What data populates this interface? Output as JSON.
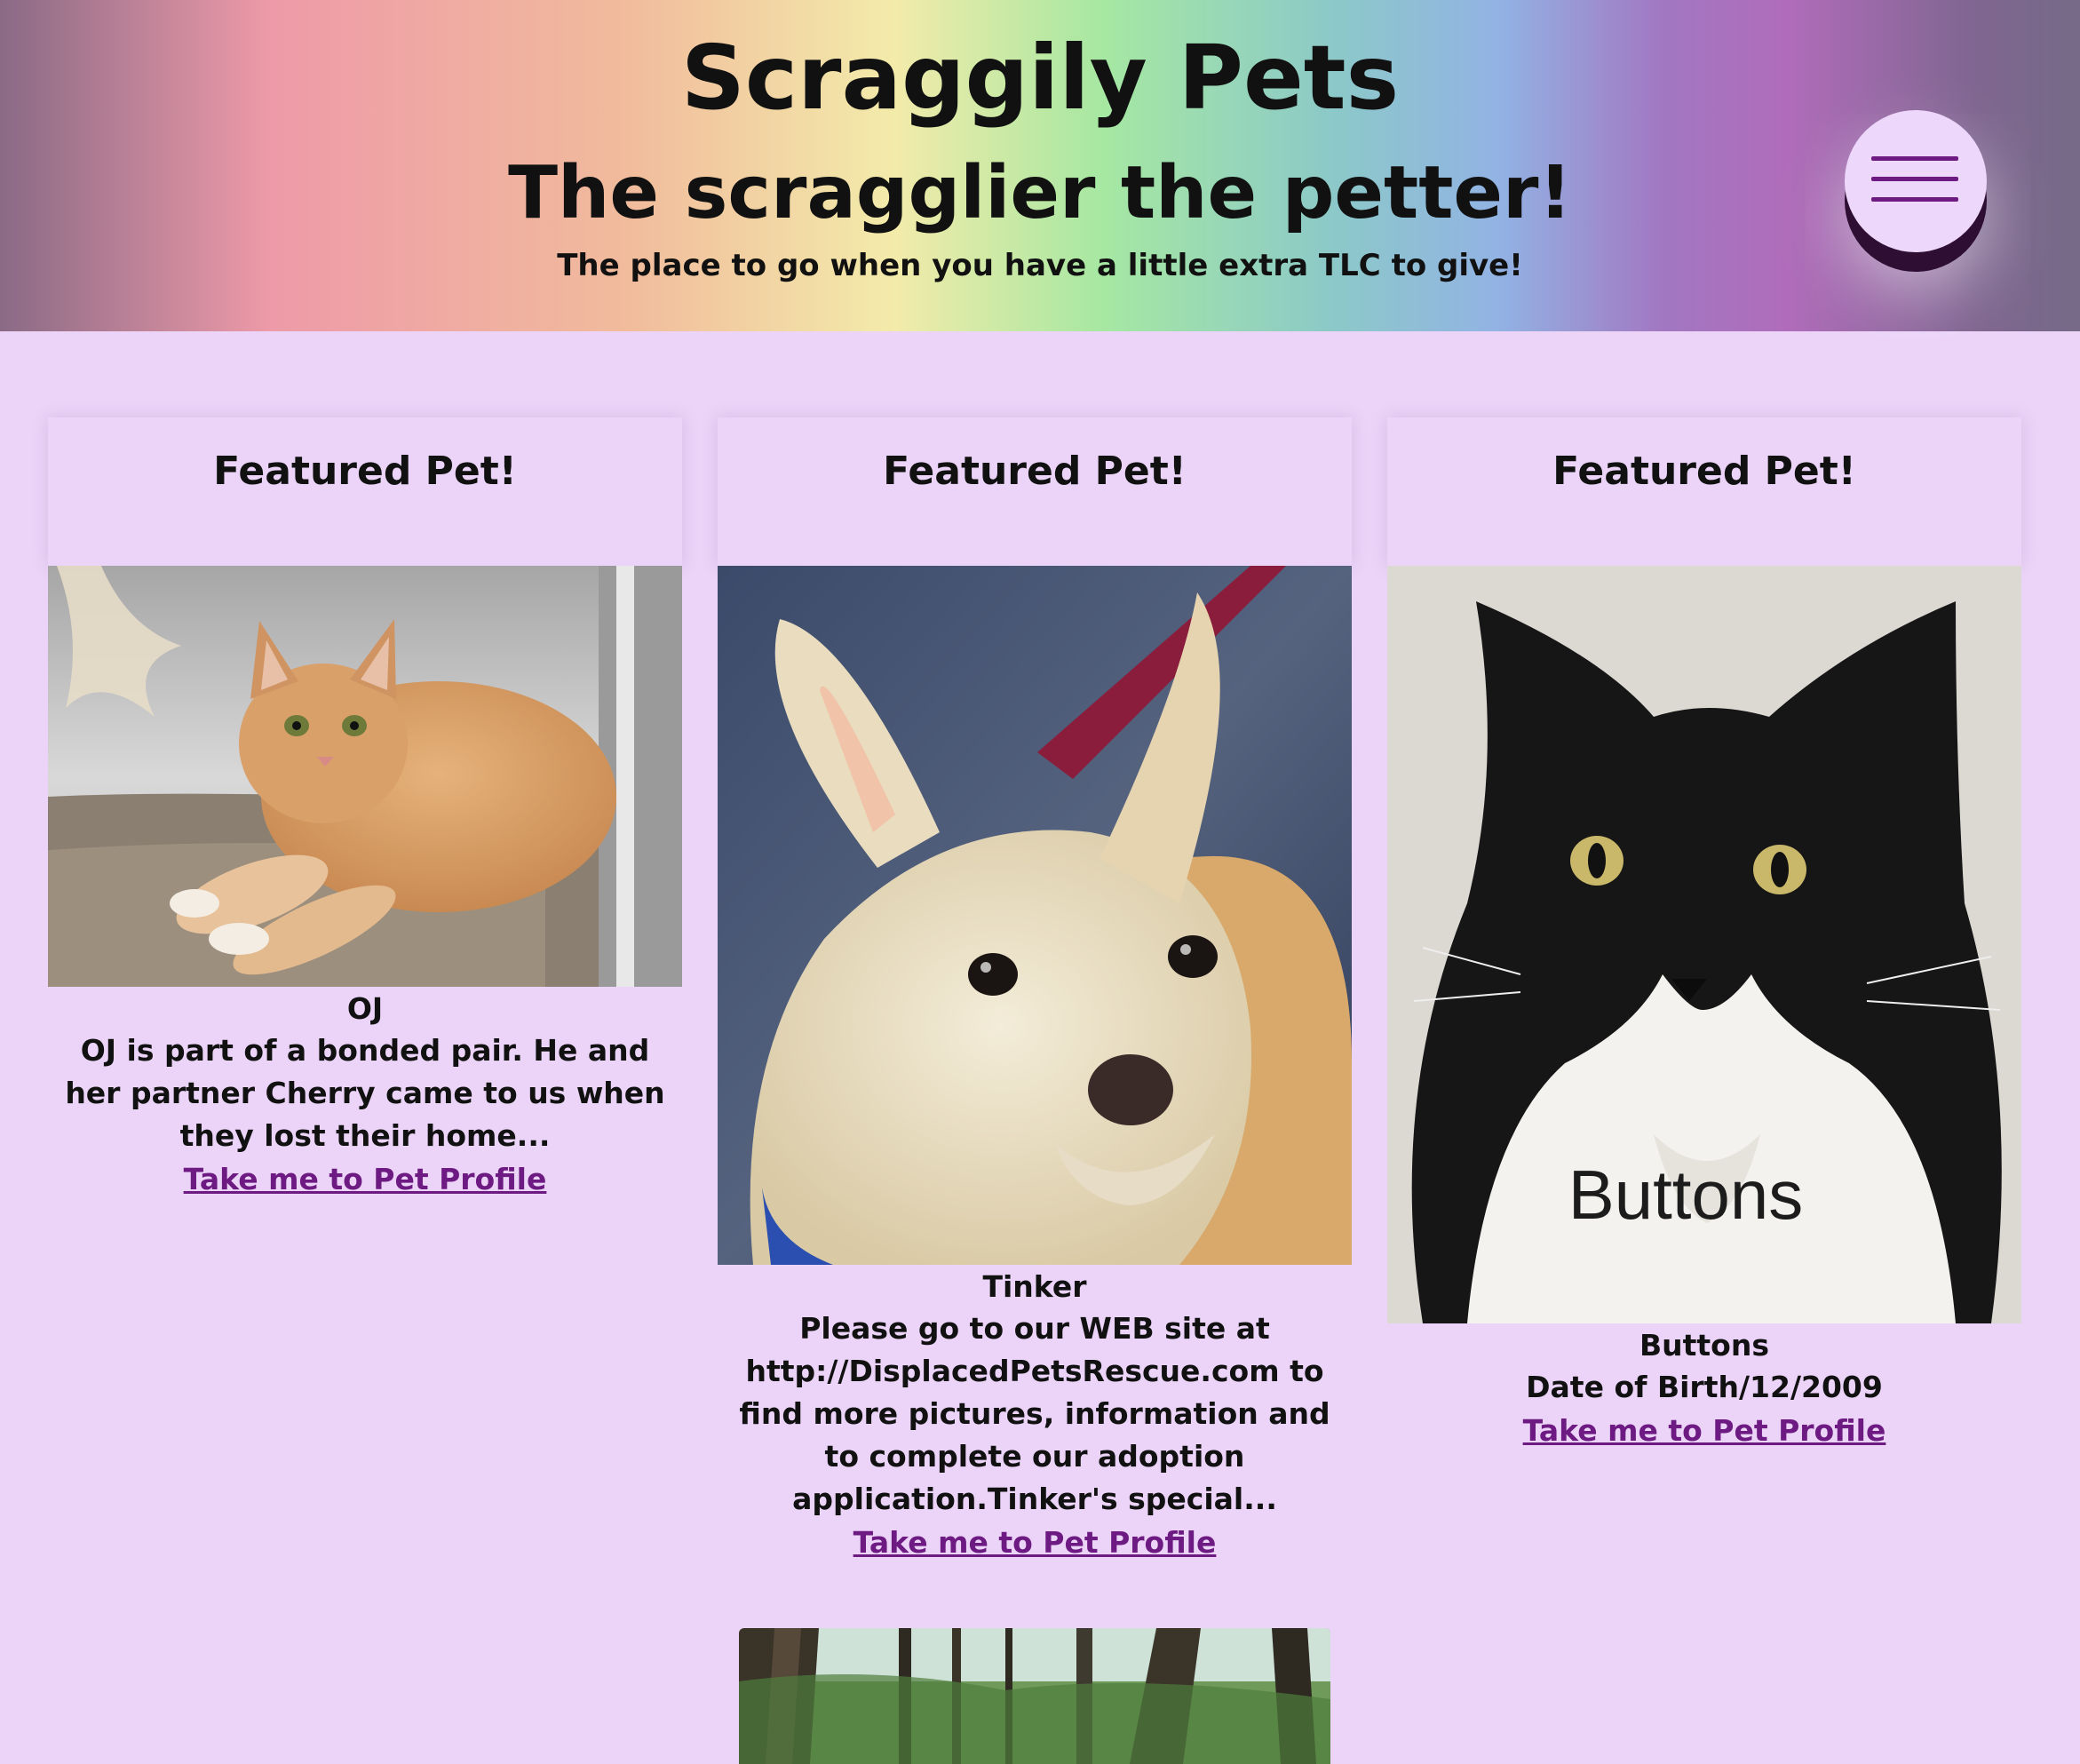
{
  "header": {
    "title": "Scraggily Pets",
    "tagline": "The scragglier the petter!",
    "subtitle": "The place to go when you have a little extra TLC to give!",
    "menu_icon": "hamburger-menu-icon"
  },
  "cards": [
    {
      "heading": "Featured Pet!",
      "name": "OJ",
      "description": "OJ is part of a bonded pair. He and her partner Cherry came to us when they lost their home...",
      "link": "Take me to Pet Profile"
    },
    {
      "heading": "Featured Pet!",
      "name": "Tinker",
      "description": "Please go to our WEB site at http://DisplacedPetsRescue.com to find more pictures, information and to complete our adoption application.Tinker's special...",
      "link": "Take me to Pet Profile"
    },
    {
      "heading": "Featured Pet!",
      "name": "Buttons",
      "description": "Date of Birth/12/2009",
      "link": "Take me to Pet Profile",
      "photo_caption": "Buttons"
    }
  ],
  "colors": {
    "background": "#ebd4f8",
    "link": "#6d1a82",
    "menu_button": "#edd7fb"
  }
}
